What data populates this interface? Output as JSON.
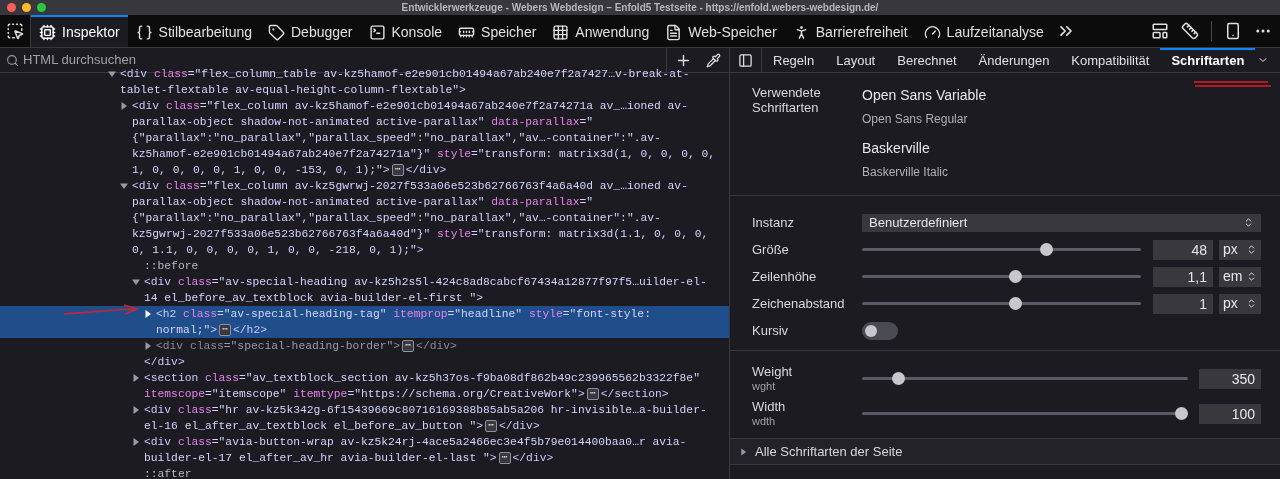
{
  "window": {
    "title": "Entwicklerwerkzeuge - Webers Webdesign – Enfold5 Testseite - https://enfold.webers-webdesign.de/"
  },
  "toolbar": {
    "tools": [
      {
        "label": "Inspektor",
        "selected": true
      },
      {
        "label": "Stilbearbeitung",
        "selected": false
      },
      {
        "label": "Debugger",
        "selected": false
      },
      {
        "label": "Konsole",
        "selected": false
      },
      {
        "label": "Speicher",
        "selected": false
      },
      {
        "label": "Anwendung",
        "selected": false
      },
      {
        "label": "Web-Speicher",
        "selected": false
      },
      {
        "label": "Barrierefreiheit",
        "selected": false
      },
      {
        "label": "Laufzeitanalyse",
        "selected": false
      }
    ]
  },
  "inspector": {
    "search": {
      "placeholder": "HTML durchsuchen"
    },
    "markup": [
      {
        "kind": "element",
        "expanded": true,
        "selected": false,
        "dimmed": false,
        "tokens": [
          {
            "kind": "tag",
            "s": "<div"
          },
          {
            "kind": "attr",
            "s": " class"
          },
          {
            "kind": "val",
            "s": "=\"flex_column_table av-kz5hamof-e2e901cb01494a67ab240e7f2a7427…v-break-at-tablet-flextable av-equal-height-column-flextable\""
          },
          {
            "kind": "tag",
            "s": ">"
          }
        ],
        "children": [
          {
            "kind": "element",
            "expanded": false,
            "selected": false,
            "dimmed": false,
            "tokens": [
              {
                "kind": "tag",
                "s": "<div"
              },
              {
                "kind": "attr",
                "s": " class"
              },
              {
                "kind": "val",
                "s": "=\"flex_column av-kz5hamof-e2e901cb01494a67ab240e7f2a74271a av_…ioned av-parallax-object shadow-not-animated active-parallax\""
              },
              {
                "kind": "attr",
                "s": " data-parallax"
              },
              {
                "kind": "val",
                "s": "=\"{\"parallax\":\"no_parallax\",\"parallax_speed\":\"no_parallax\",\"av…-container\":\".av-kz5hamof-e2e901cb01494a67ab240e7f2a74271a\"}\""
              },
              {
                "kind": "attr",
                "s": " style"
              },
              {
                "kind": "val",
                "s": "=\"transform: matrix3d(1, 0, 0, 0, 0, 1, 0, 0, 0, 0, 1, 0, 0, -153, 0, 1);\""
              },
              {
                "kind": "tag",
                "s": ">"
              },
              {
                "kind": "badge",
                "s": "⋯"
              },
              {
                "kind": "tag",
                "s": "</div>"
              }
            ]
          },
          {
            "kind": "element",
            "expanded": true,
            "selected": false,
            "dimmed": false,
            "tokens": [
              {
                "kind": "tag",
                "s": "<div"
              },
              {
                "kind": "attr",
                "s": " class"
              },
              {
                "kind": "val",
                "s": "=\"flex_column av-kz5gwrwj-2027f533a06e523b62766763f4a6a40d av_…ioned av-parallax-object shadow-not-animated active-parallax\""
              },
              {
                "kind": "attr",
                "s": " data-parallax"
              },
              {
                "kind": "val",
                "s": "=\"{\"parallax\":\"no_parallax\",\"parallax_speed\":\"no_parallax\",\"av…-container\":\".av-kz5gwrwj-2027f533a06e523b62766763f4a6a40d\"}\""
              },
              {
                "kind": "attr",
                "s": " style"
              },
              {
                "kind": "val",
                "s": "=\"transform: matrix3d(1.1, 0, 0, 0, 0, 1.1, 0, 0, 0, 0, 1, 0, 0, -218, 0, 1);\""
              },
              {
                "kind": "tag",
                "s": ">"
              }
            ],
            "children": [
              {
                "kind": "pseudo",
                "tokens": [
                  {
                    "kind": "pseudo",
                    "s": "::before"
                  }
                ]
              },
              {
                "kind": "element",
                "expanded": true,
                "selected": false,
                "dimmed": false,
                "tokens": [
                  {
                    "kind": "tag",
                    "s": "<div"
                  },
                  {
                    "kind": "attr",
                    "s": " class"
                  },
                  {
                    "kind": "val",
                    "s": "=\"av-special-heading av-kz5h2s5l-424c8ad8cabcf67434a12877f97f5…uilder-el-14 el_before_av_textblock avia-builder-el-first \""
                  },
                  {
                    "kind": "tag",
                    "s": ">"
                  }
                ],
                "children": [
                  {
                    "kind": "element",
                    "expanded": false,
                    "selected": true,
                    "dimmed": false,
                    "tokens": [
                      {
                        "kind": "tag",
                        "s": "<h2"
                      },
                      {
                        "kind": "attr",
                        "s": " class"
                      },
                      {
                        "kind": "val",
                        "s": "=\"av-special-heading-tag\""
                      },
                      {
                        "kind": "attr",
                        "s": " itemprop"
                      },
                      {
                        "kind": "val",
                        "s": "=\"headline\""
                      },
                      {
                        "kind": "attr",
                        "s": " style"
                      },
                      {
                        "kind": "val",
                        "s": "=\"font-style: normal;\""
                      },
                      {
                        "kind": "tag",
                        "s": ">"
                      },
                      {
                        "kind": "badge",
                        "s": "⋯"
                      },
                      {
                        "kind": "tag",
                        "s": "</h2>"
                      }
                    ]
                  },
                  {
                    "kind": "element",
                    "expanded": false,
                    "selected": false,
                    "dimmed": true,
                    "tokens": [
                      {
                        "kind": "tag",
                        "s": "<div"
                      },
                      {
                        "kind": "attr",
                        "s": " class"
                      },
                      {
                        "kind": "val",
                        "s": "=\"special-heading-border\""
                      },
                      {
                        "kind": "tag",
                        "s": ">"
                      },
                      {
                        "kind": "badge",
                        "s": "⋯"
                      },
                      {
                        "kind": "tag",
                        "s": "</div>"
                      }
                    ]
                  }
                ],
                "close_tokens": [
                  {
                    "kind": "tag",
                    "s": "</div>"
                  }
                ]
              },
              {
                "kind": "element",
                "expanded": false,
                "selected": false,
                "dimmed": false,
                "tokens": [
                  {
                    "kind": "tag",
                    "s": "<section"
                  },
                  {
                    "kind": "attr",
                    "s": " class"
                  },
                  {
                    "kind": "val",
                    "s": "=\"av_textblock_section av-kz5h37os-f9ba08df862b49c239965562b3322f8e\""
                  },
                  {
                    "kind": "attr",
                    "s": " itemscope"
                  },
                  {
                    "kind": "val",
                    "s": "=\"itemscope\""
                  },
                  {
                    "kind": "attr",
                    "s": " itemtype"
                  },
                  {
                    "kind": "val",
                    "s": "=\"https://schema.org/CreativeWork\""
                  },
                  {
                    "kind": "tag",
                    "s": ">"
                  },
                  {
                    "kind": "badge",
                    "s": "⋯"
                  },
                  {
                    "kind": "tag",
                    "s": "</section>"
                  }
                ]
              },
              {
                "kind": "element",
                "expanded": false,
                "selected": false,
                "dimmed": false,
                "tokens": [
                  {
                    "kind": "tag",
                    "s": "<div"
                  },
                  {
                    "kind": "attr",
                    "s": " class"
                  },
                  {
                    "kind": "val",
                    "s": "=\"hr av-kz5k342g-6f15439669c80716169388b85ab5a206 hr-invisible…a-builder-el-16 el_after_av_textblock el_before_av_button \""
                  },
                  {
                    "kind": "tag",
                    "s": ">"
                  },
                  {
                    "kind": "badge",
                    "s": "⋯"
                  },
                  {
                    "kind": "tag",
                    "s": "</div>"
                  }
                ]
              },
              {
                "kind": "element",
                "expanded": false,
                "selected": false,
                "dimmed": false,
                "tokens": [
                  {
                    "kind": "tag",
                    "s": "<div"
                  },
                  {
                    "kind": "attr",
                    "s": " class"
                  },
                  {
                    "kind": "val",
                    "s": "=\"avia-button-wrap av-kz5k24rj-4ace5a2466ec3e4f5b79e014400baa0…r avia-builder-el-17 el_after_av_hr avia-builder-el-last \""
                  },
                  {
                    "kind": "tag",
                    "s": ">"
                  },
                  {
                    "kind": "badge",
                    "s": "⋯"
                  },
                  {
                    "kind": "tag",
                    "s": "</div>"
                  }
                ]
              },
              {
                "kind": "pseudo",
                "tokens": [
                  {
                    "kind": "pseudo",
                    "s": "::after"
                  }
                ]
              }
            ]
          }
        ]
      }
    ]
  },
  "sidebar": {
    "tabs": [
      {
        "label": "Regeln",
        "selected": false
      },
      {
        "label": "Layout",
        "selected": false
      },
      {
        "label": "Berechnet",
        "selected": false
      },
      {
        "label": "Änderungen",
        "selected": false
      },
      {
        "label": "Kompatibilität",
        "selected": false
      },
      {
        "label": "Schriftarten",
        "selected": true
      }
    ],
    "fonts_used": {
      "label": "Verwendete Schriftarten",
      "fonts": [
        {
          "name": "Open Sans Variable",
          "face": "Open Sans Regular"
        },
        {
          "name": "Baskerville",
          "face": "Baskerville Italic"
        }
      ]
    },
    "settings": [
      {
        "kind": "select",
        "label": "Instanz",
        "value": "Benutzerdefiniert"
      },
      {
        "kind": "slider",
        "label": "Größe",
        "level": 0.66,
        "value": "48",
        "unit": "px"
      },
      {
        "kind": "slider",
        "label": "Zeilenhöhe",
        "level": 0.55,
        "value": "1,1",
        "unit": "em"
      },
      {
        "kind": "slider",
        "label": "Zeichenabstand",
        "level": 0.55,
        "value": "1",
        "unit": "px"
      },
      {
        "kind": "toggle",
        "label": "Kursiv",
        "on": false
      }
    ],
    "axes": [
      {
        "label": "Weight",
        "tag": "wght",
        "level": 0.11,
        "value": "350"
      },
      {
        "label": "Width",
        "tag": "wdth",
        "level": 0.98,
        "value": "100"
      }
    ],
    "all_fonts": {
      "label": "Alle Schriftarten der Seite",
      "expanded": false
    }
  }
}
